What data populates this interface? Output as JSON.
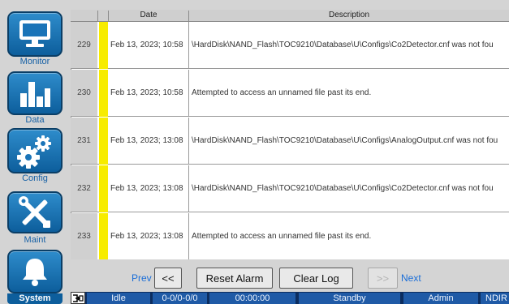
{
  "sidebar": {
    "items": [
      {
        "label": "Monitor",
        "icon": "monitor-icon"
      },
      {
        "label": "Data",
        "icon": "bar-chart-icon"
      },
      {
        "label": "Config",
        "icon": "gears-icon"
      },
      {
        "label": "Maint",
        "icon": "tools-icon"
      },
      {
        "label": "System",
        "icon": "bell-icon"
      }
    ],
    "active": "System"
  },
  "table": {
    "headers": {
      "date": "Date",
      "description": "Description"
    },
    "rows": [
      {
        "num": "229",
        "date": "Feb 13, 2023; 10:58",
        "desc": "\\HardDisk\\NAND_Flash\\TOC9210\\Database\\U\\Configs\\Co2Detector.cnf was not fou"
      },
      {
        "num": "230",
        "date": "Feb 13, 2023; 10:58",
        "desc": "Attempted to access an unnamed file past its end."
      },
      {
        "num": "231",
        "date": "Feb 13, 2023; 13:08",
        "desc": "\\HardDisk\\NAND_Flash\\TOC9210\\Database\\U\\Configs\\AnalogOutput.cnf was not fou"
      },
      {
        "num": "232",
        "date": "Feb 13, 2023; 13:08",
        "desc": "\\HardDisk\\NAND_Flash\\TOC9210\\Database\\U\\Configs\\Co2Detector.cnf was not fou"
      },
      {
        "num": "233",
        "date": "Feb 13, 2023; 13:08",
        "desc": "Attempted to access an unnamed file past its end."
      }
    ],
    "severity_color": "#f7ec00"
  },
  "controls": {
    "prev_label": "Prev",
    "first_label": "<<",
    "reset_alarm_label": "Reset Alarm",
    "clear_log_label": "Clear Log",
    "last_label": ">>",
    "next_label": "Next"
  },
  "statusbar": {
    "state": "Idle",
    "code": "0-0/0-0/0",
    "time": "00:00:00",
    "mode": "Standby",
    "user": "Admin",
    "detector": "NDIR"
  },
  "colors": {
    "accent": "#0d5e9c",
    "statusbar_bg": "#1f5aa6",
    "link": "#1a6ed8"
  }
}
